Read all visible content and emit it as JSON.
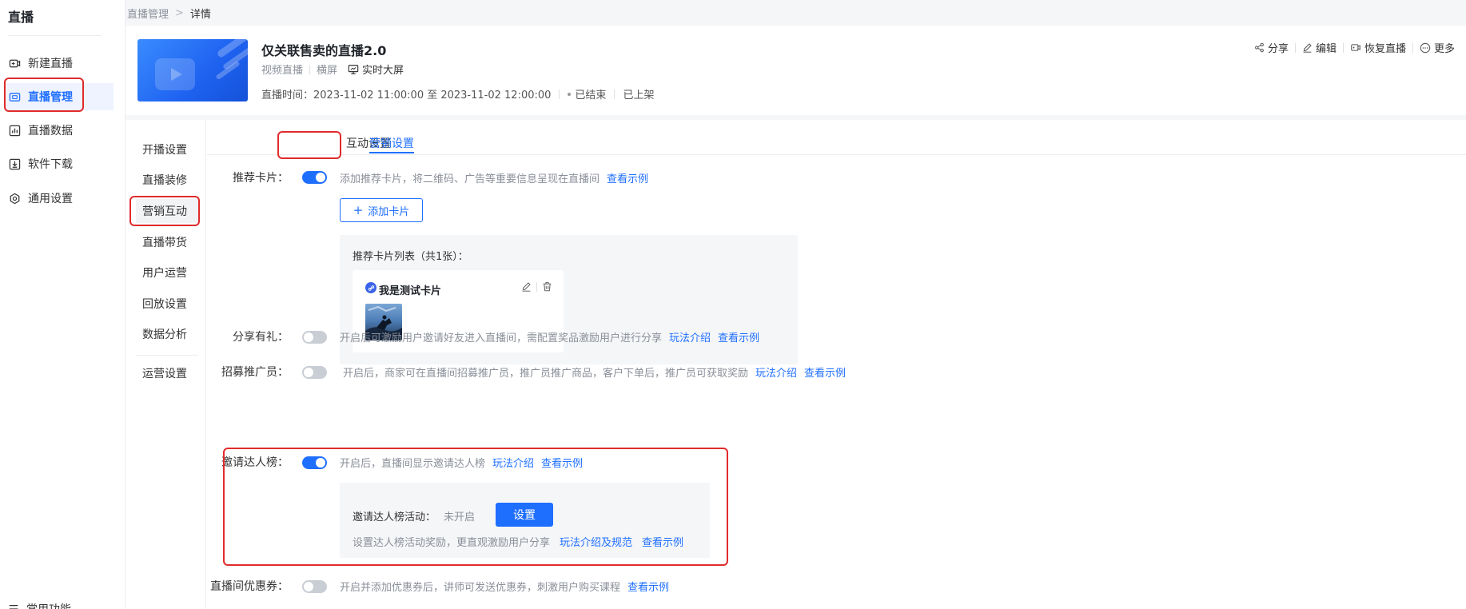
{
  "app": {
    "title": "直播"
  },
  "sidebar": {
    "items": [
      {
        "label": "新建直播",
        "icon": "video-add-icon"
      },
      {
        "label": "直播管理",
        "icon": "live-manage-icon"
      },
      {
        "label": "直播数据",
        "icon": "chart-icon"
      },
      {
        "label": "软件下载",
        "icon": "download-icon"
      },
      {
        "label": "通用设置",
        "icon": "gear-icon"
      }
    ],
    "bottom_label": "常用功能"
  },
  "breadcrumb": {
    "parent": "直播管理",
    "separator": ">",
    "current": "详情"
  },
  "live": {
    "title": "仅关联售卖的直播2.0",
    "type": "视频直播",
    "orientation": "横屏",
    "screen_label": "实时大屏",
    "time_label": "直播时间：",
    "time_range": "2023-11-02 11:00:00 至 2023-11-02 12:00:00",
    "status": "已结束",
    "listing": "已上架"
  },
  "header_actions": {
    "share": "分享",
    "edit": "编辑",
    "restore": "恢复直播",
    "more": "更多"
  },
  "sub_nav": {
    "items": [
      "开播设置",
      "直播装修",
      "营销互动",
      "直播带货",
      "用户运营",
      "回放设置",
      "数据分析",
      "运营设置"
    ]
  },
  "tabs": [
    {
      "label": "互动设置"
    },
    {
      "label": "营销设置"
    }
  ],
  "settings": {
    "recommend_card": {
      "label": "推荐卡片：",
      "desc": "添加推荐卡片，将二维码、广告等重要信息呈现在直播间",
      "link": "查看示例",
      "enabled": true,
      "add_button": "添加卡片",
      "list_title": "推荐卡片列表（共1张）：",
      "card_name": "我是测试卡片"
    },
    "share_gift": {
      "label": "分享有礼：",
      "desc": "开启后可激励用户邀请好友进入直播间，需配置奖品激励用户进行分享",
      "link1": "玩法介绍",
      "link2": "查看示例",
      "enabled": false
    },
    "promoter": {
      "label": "招募推广员：",
      "desc": "开启后，商家可在直播间招募推广员，推广员推广商品，客户下单后，推广员可获取奖励",
      "link1": "玩法介绍",
      "link2": "查看示例",
      "enabled": false
    },
    "invite_rank": {
      "label": "邀请达人榜：",
      "desc": "开启后，直播间显示邀请达人榜",
      "link1": "玩法介绍",
      "link2": "查看示例",
      "enabled": true,
      "activity_label": "邀请达人榜活动：",
      "activity_state": "未开启",
      "set_button": "设置",
      "note": "设置达人榜活动奖励，更直观激励用户分享",
      "note_link1": "玩法介绍及规范",
      "note_link2": "查看示例"
    },
    "coupon": {
      "label": "直播间优惠券：",
      "desc": "开启并添加优惠券后，讲师可发送优惠券，刺激用户购买课程",
      "link": "查看示例",
      "enabled": false
    }
  },
  "colors": {
    "accent": "#1f6fff",
    "highlight": "#e02b2b"
  }
}
